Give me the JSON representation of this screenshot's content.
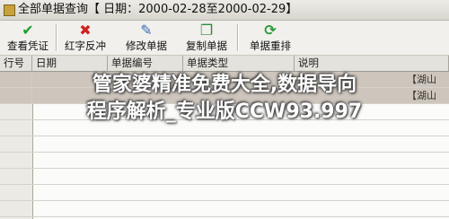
{
  "window": {
    "title": "全部单据查询【 日期：2000-02-28至2000-02-29】"
  },
  "toolbar": {
    "buttons": [
      {
        "label": "查看凭证",
        "icon": "check-icon",
        "color": "#1f9d2c",
        "glyph": "✔"
      },
      {
        "label": "红字反冲",
        "icon": "red-x-icon",
        "color": "#d0221f",
        "glyph": "✖"
      },
      {
        "label": "修改单据",
        "icon": "edit-icon",
        "color": "#3b6fb5",
        "glyph": "✎"
      },
      {
        "label": "复制单据",
        "icon": "copy-icon",
        "color": "#2a8a3a",
        "glyph": "❐"
      },
      {
        "label": "单据重排",
        "icon": "refresh-icon",
        "color": "#2c9a3a",
        "glyph": "⟳"
      }
    ]
  },
  "grid": {
    "columns": [
      "行号",
      "日期",
      "单据编号",
      "单据类型",
      "说明"
    ],
    "rows": [
      {
        "no": "",
        "date": "",
        "code": "",
        "type": "",
        "note": "【湖山"
      },
      {
        "no": "",
        "date": "",
        "code": "",
        "type": "",
        "note": "【湖山"
      }
    ]
  },
  "overlay": {
    "line1": "管家婆精准免费大全,数据导向",
    "line2": "程序解析_专业版CCW93.997"
  },
  "colors": {
    "selected_row": "#cec6bd",
    "header": "#e4e2dc"
  }
}
